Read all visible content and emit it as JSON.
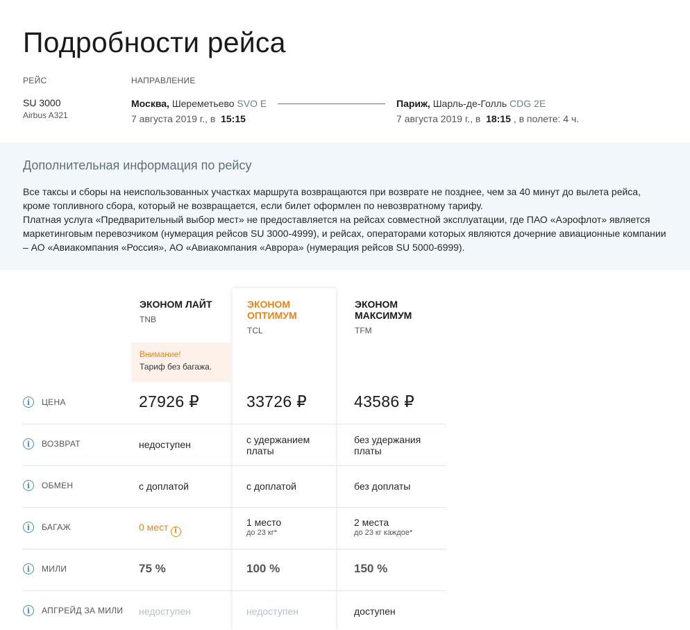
{
  "page": {
    "title": "Подробности рейса"
  },
  "flight": {
    "caption": "РЕЙС",
    "number": "SU 3000",
    "aircraft": "Airbus A321"
  },
  "route": {
    "caption": "НАПРАВЛЕНИЕ",
    "from": {
      "city": "Москва,",
      "airport": "Шереметьево",
      "code": "SVO E",
      "date": "7 августа 2019 г., в",
      "time": "15:15"
    },
    "to": {
      "city": "Париж,",
      "airport": "Шарль-де-Голль",
      "code": "CDG 2E",
      "date": "7 августа 2019 г., в",
      "time": "18:15",
      "duration": ", в полете: 4 ч."
    }
  },
  "info": {
    "title": "Дополнительная информация по рейсу",
    "paragraph1": "Все таксы и сборы на неиспользованных участках маршрута возвращаются при возврате не позднее, чем за 40 минут до вылета рейса, кроме топливного сбора, который не возвращается, если билет оформлен по невозвратному тарифу.",
    "paragraph2": "Платная услуга «Предварительный выбор мест» не предоставляется на рейсах совместной эксплуатации, где ПАО «Аэрофлот» является маркетинговым перевозчиком (нумерация рейсов SU 3000-4999), и рейсах, операторами которых являются дочерние авиационные компании – АО «Авиакомпания «Россия», АО «Авиакомпания «Аврора» (нумерация рейсов SU 5000-6999)."
  },
  "tariffs": [
    {
      "name": "ЭКОНОМ ЛАЙТ",
      "code": "TNB",
      "highlight": false
    },
    {
      "name": "ЭКОНОМ ОПТИМУМ",
      "code": "TCL",
      "highlight": true
    },
    {
      "name": "ЭКОНОМ МАКСИМУМ",
      "code": "TFM",
      "highlight": false
    }
  ],
  "warning": {
    "title": "Внимание!",
    "text": "Тариф без багажа."
  },
  "rows": {
    "price": {
      "label": "ЦЕНА",
      "values": [
        "27926 ₽",
        "33726 ₽",
        "43586 ₽"
      ]
    },
    "refund": {
      "label": "ВОЗВРАТ",
      "values": [
        "недоступен",
        "с удержанием платы",
        "без удержания платы"
      ]
    },
    "exchange": {
      "label": "ОБМЕН",
      "values": [
        "с доплатой",
        "с доплатой",
        "без доплаты"
      ]
    },
    "baggage": {
      "label": "БАГАЖ",
      "values": [
        "0 мест",
        "1 место",
        "2 места"
      ],
      "subs": [
        "",
        "до 23 кг*",
        "до 23 кг каждое*"
      ]
    },
    "miles": {
      "label": "МИЛИ",
      "values": [
        "75 %",
        "100 %",
        "150 %"
      ]
    },
    "upgrade": {
      "label": "АПГРЕЙД ЗА МИЛИ",
      "values": [
        "недоступен",
        "недоступен",
        "доступен"
      ]
    }
  },
  "colors": {
    "accent": "#e8841a",
    "info_icon": "#4b8dbf",
    "info_bg": "#f2f7fb",
    "route_line": "#3c7fa8"
  }
}
